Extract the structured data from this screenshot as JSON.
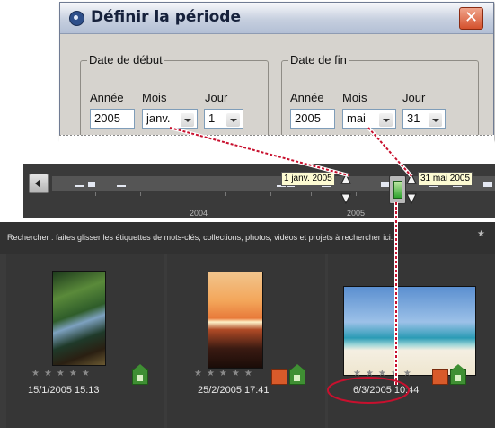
{
  "dialog": {
    "title": "Définir la période",
    "close_icon": "close-icon",
    "start": {
      "legend": "Date de début",
      "year_label": "Année",
      "month_label": "Mois",
      "day_label": "Jour",
      "year_value": "2005",
      "month_value": "janv.",
      "day_value": "1"
    },
    "end": {
      "legend": "Date de fin",
      "year_label": "Année",
      "month_label": "Mois",
      "day_label": "Jour",
      "year_value": "2005",
      "month_value": "mai",
      "day_value": "31"
    }
  },
  "timeline": {
    "years": [
      "2004",
      "2005"
    ],
    "start_callout": "1 janv. 2005",
    "end_callout": "31 mai 2005"
  },
  "search": {
    "text": "Rechercher : faites glisser les étiquettes de mots-clés, collections, photos, vidéos et projets à rechercher ici.",
    "star": "★"
  },
  "photos": [
    {
      "date": "15/1/2005 15:13",
      "stars": "★★★★★",
      "tags": [
        "house-tag-icon"
      ]
    },
    {
      "date": "25/2/2005 17:41",
      "stars": "★★★★★",
      "tags": [
        "orange-tag-icon",
        "house-tag-icon"
      ]
    },
    {
      "date": "6/3/2005 10:44",
      "stars": "★★★★★",
      "tags": [
        "orange-tag-icon",
        "house-tag-icon"
      ]
    }
  ],
  "colors": {
    "callout_line": "#c8102e",
    "panel": "#3b3b3b",
    "dialog": "#d6d3ce"
  }
}
